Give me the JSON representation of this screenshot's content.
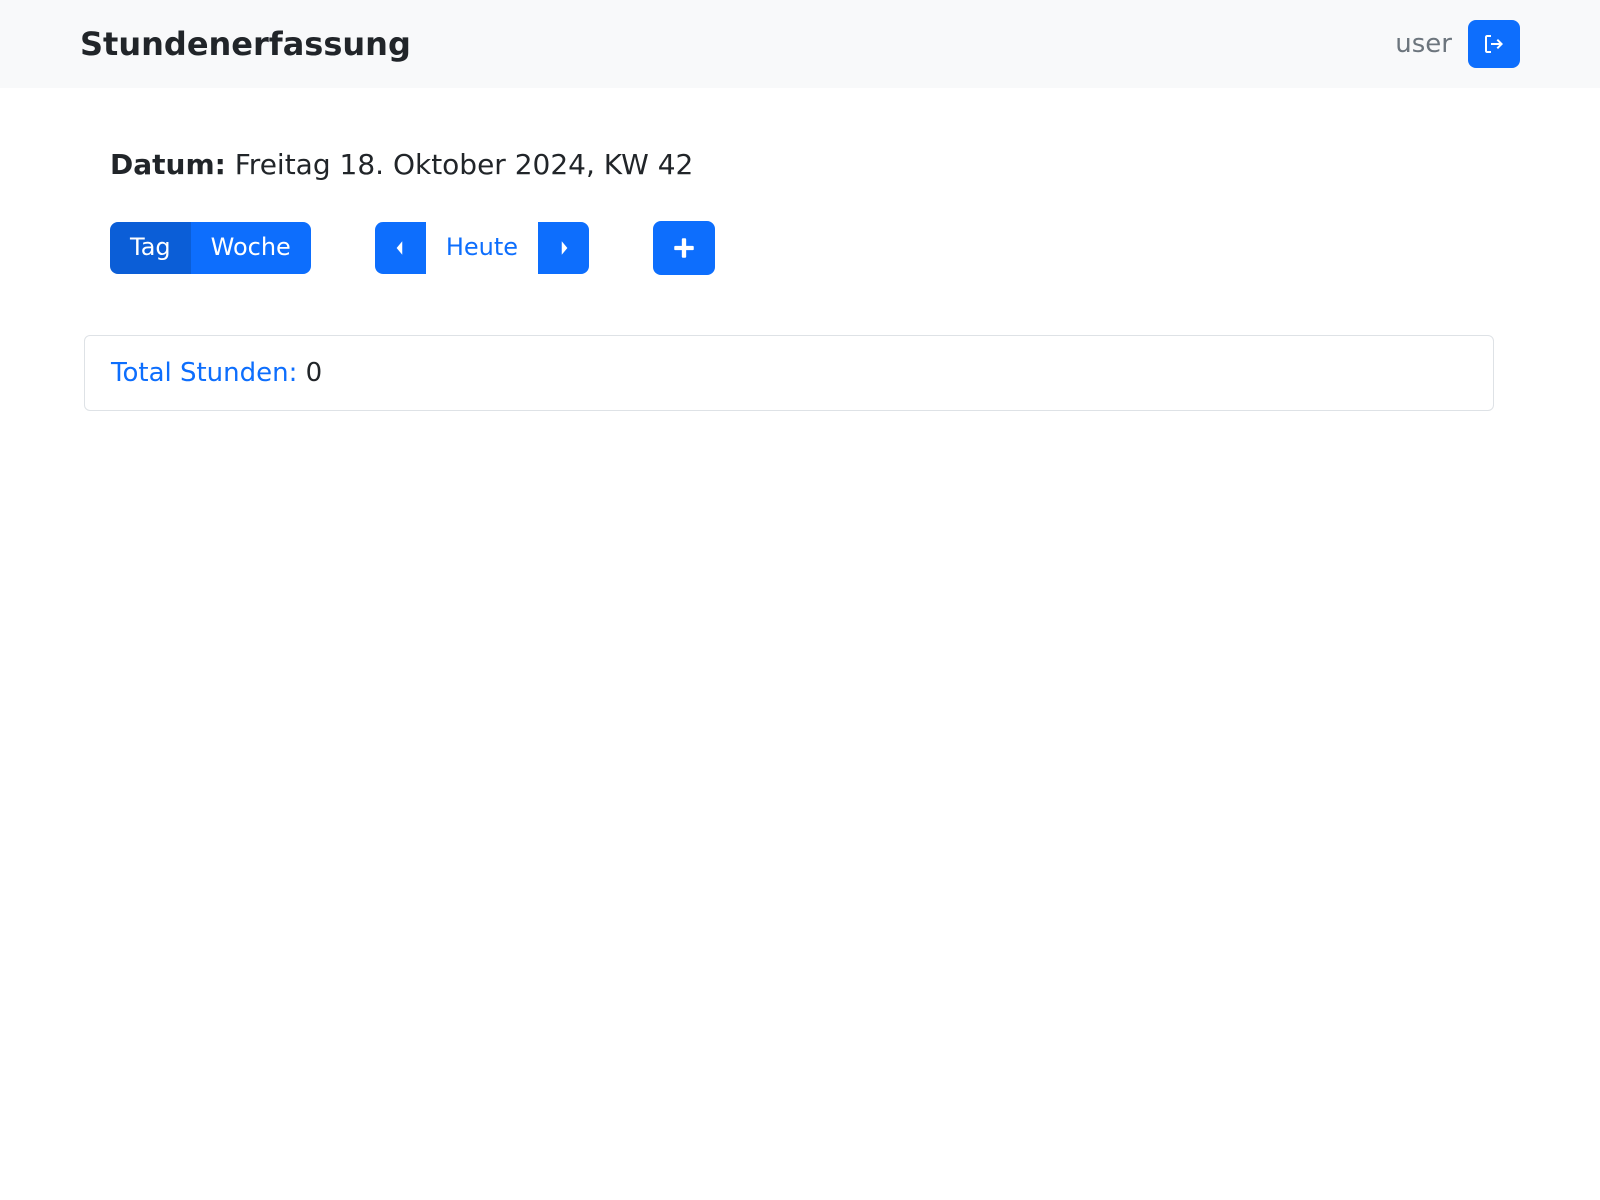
{
  "header": {
    "title": "Stundenerfassung",
    "username": "user"
  },
  "date": {
    "label": "Datum:",
    "value": "Freitag 18. Oktober 2024, KW 42"
  },
  "viewToggle": {
    "day": "Tag",
    "week": "Woche",
    "active": "day"
  },
  "nav": {
    "today": "Heute"
  },
  "totals": {
    "label": "Total Stunden:",
    "value": "0"
  }
}
